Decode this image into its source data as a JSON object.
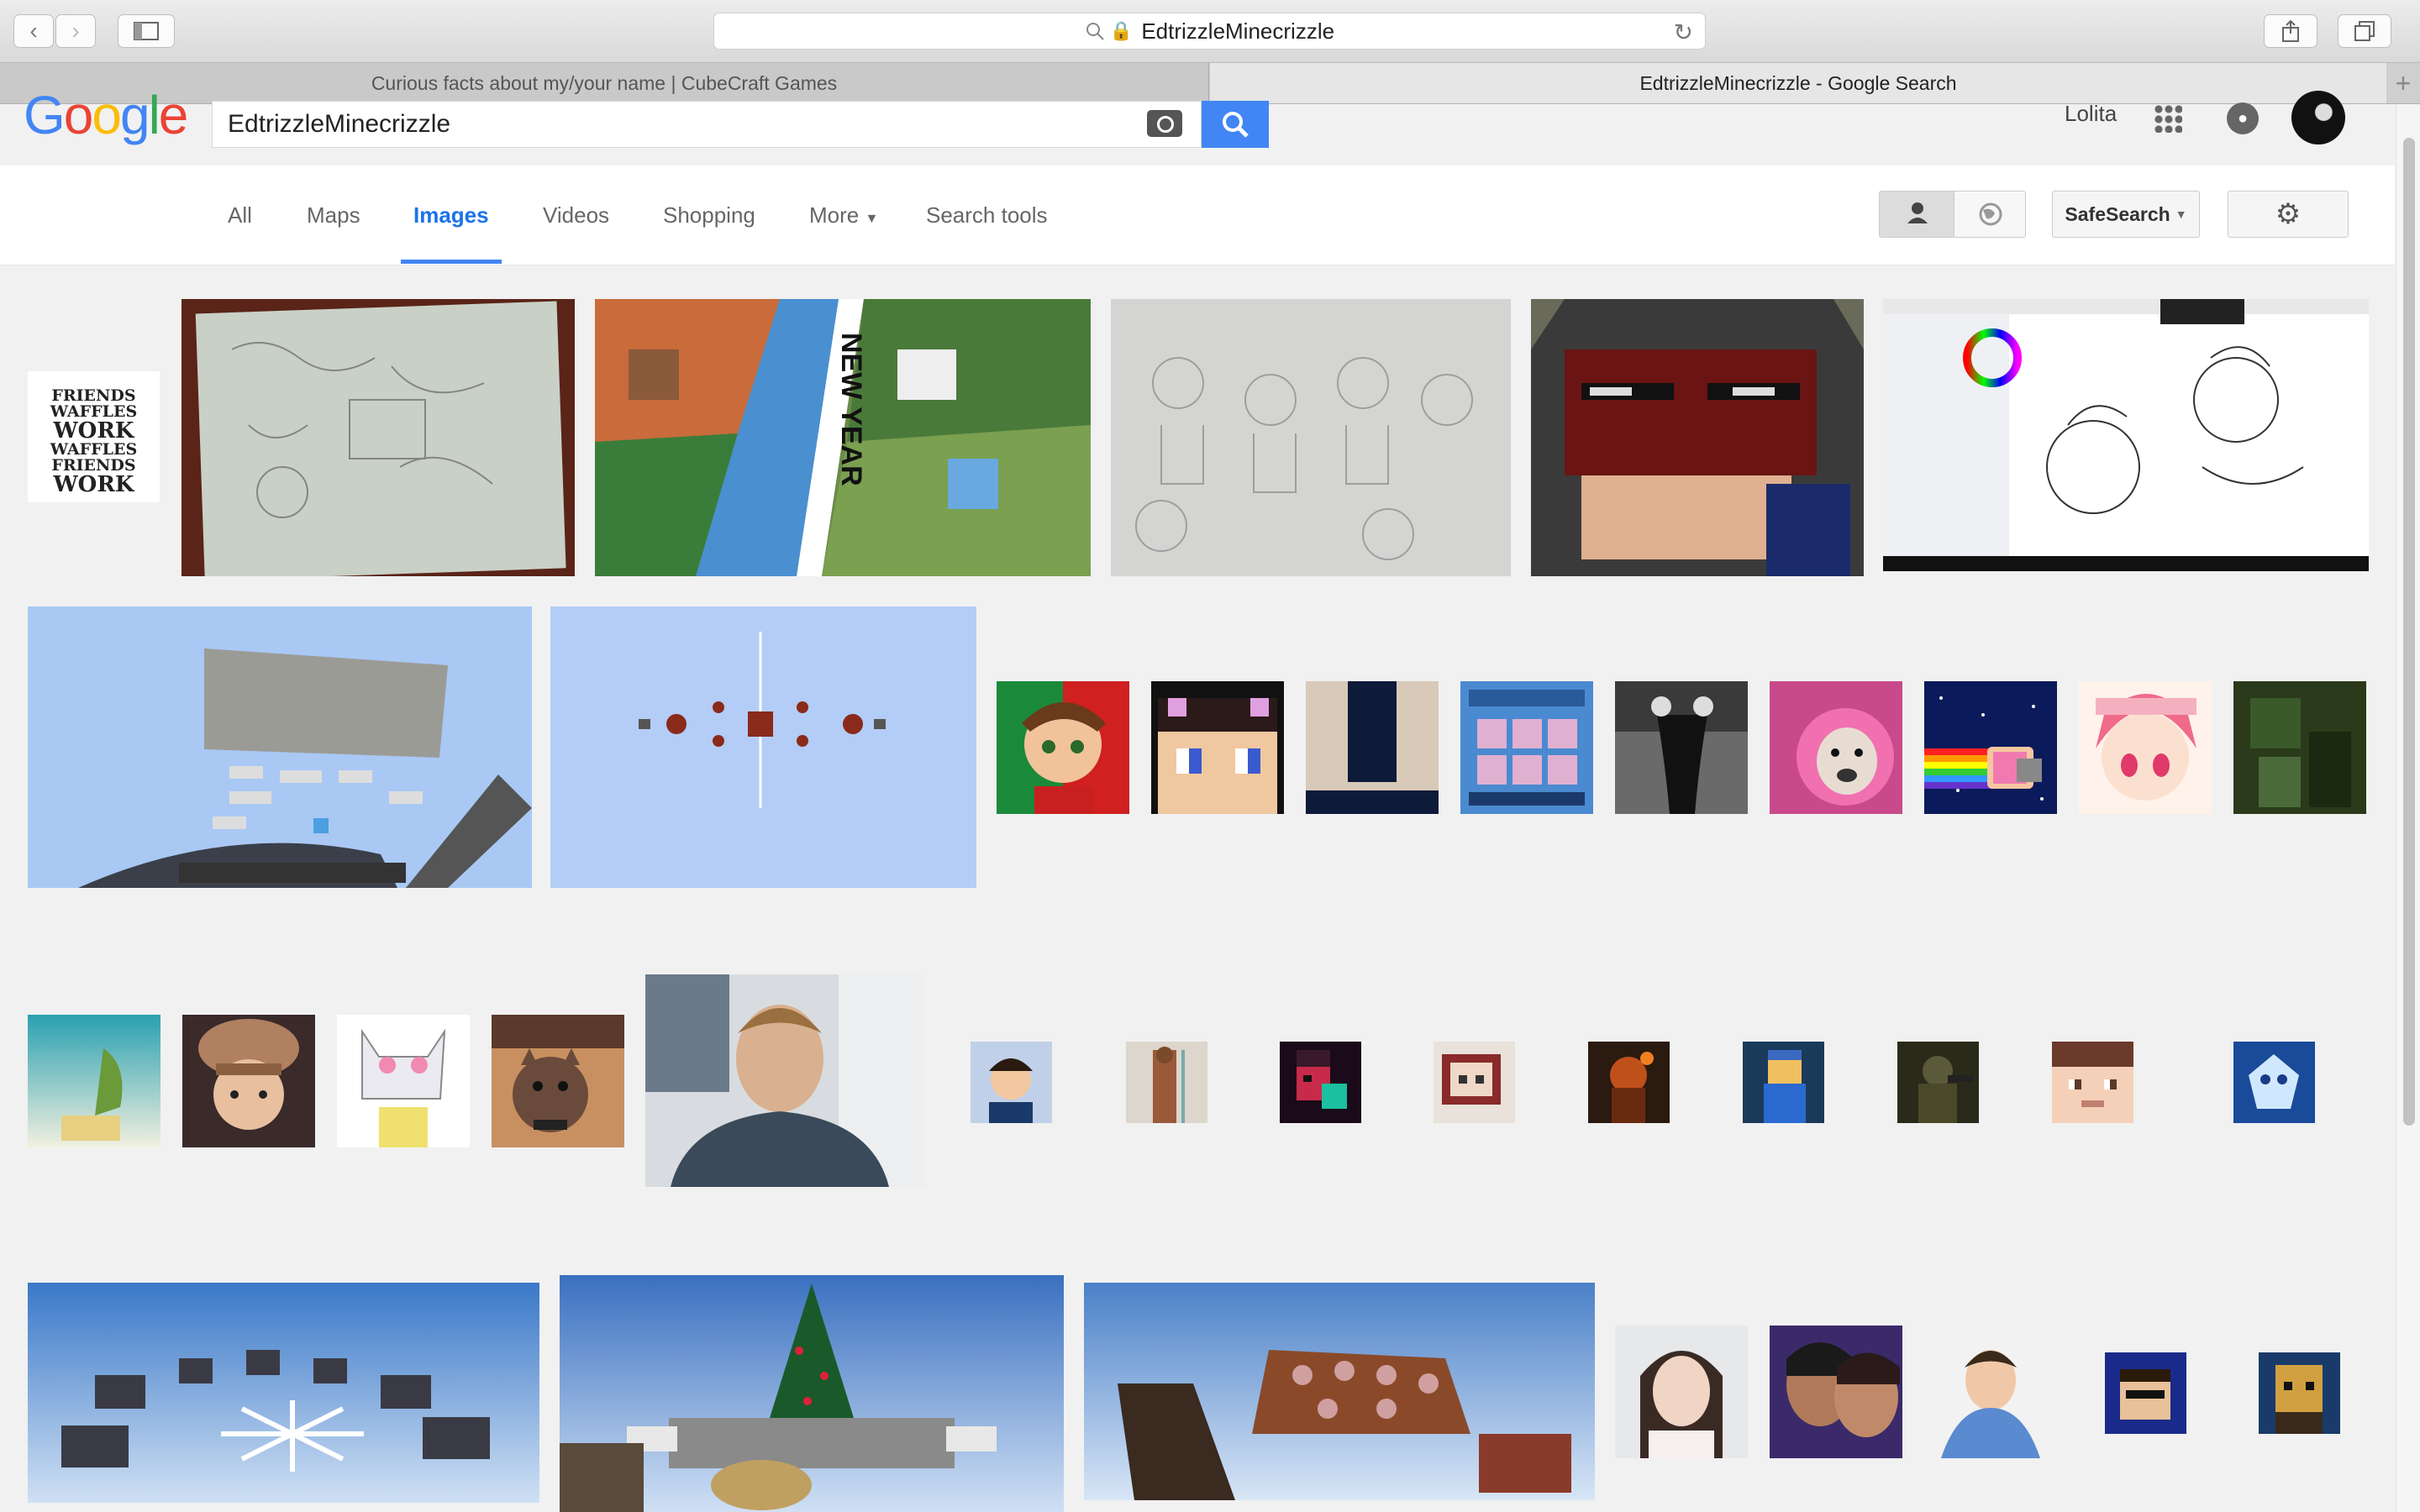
{
  "browser": {
    "url": "EdtrizzleMinecrizzle",
    "tabs": [
      {
        "title": "Curious facts about my/your name | CubeCraft Games",
        "active": false
      },
      {
        "title": "EdtrizzleMinecrizzle - Google Search",
        "active": true
      }
    ]
  },
  "google": {
    "logo": "Google",
    "query": "EdtrizzleMinecrizzle",
    "user_name": "Lolita",
    "nav": {
      "all": "All",
      "maps": "Maps",
      "images": "Images",
      "videos": "Videos",
      "shopping": "Shopping",
      "more": "More",
      "search_tools": "Search tools"
    },
    "safesearch": "SafeSearch"
  },
  "thumbs": {
    "friends_text": [
      "FRIENDS",
      "WAFFLES",
      "WORK",
      "WAFFLES",
      "FRIENDS",
      "WORK"
    ],
    "new_year_text": "NEW YEAR"
  },
  "colors": {
    "accent": "#4285f4",
    "page_bg": "#f1f1f1"
  },
  "icons": [
    "back-icon",
    "forward-icon",
    "sidebar-icon",
    "search-icon",
    "lock-icon",
    "reload-icon",
    "share-icon",
    "tabs-icon",
    "camera-icon",
    "apps-icon",
    "bell-icon",
    "person-icon",
    "globe-icon",
    "gear-icon"
  ]
}
